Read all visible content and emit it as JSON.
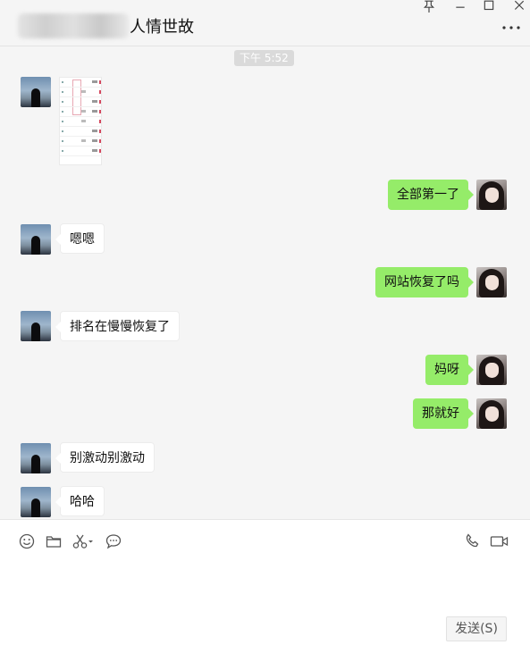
{
  "window": {
    "pin_icon": "pin-icon",
    "minimize_icon": "minimize-icon",
    "maximize_icon": "maximize-icon",
    "close_icon": "close-icon"
  },
  "header": {
    "contact_name": "人情世故",
    "more_icon": "more-dots-icon"
  },
  "chat": {
    "timestamp": "下午 5:52",
    "messages": [
      {
        "side": "left",
        "type": "image"
      },
      {
        "side": "right",
        "text": "全部第一了"
      },
      {
        "side": "left",
        "text": "嗯嗯"
      },
      {
        "side": "right",
        "text": "网站恢复了吗"
      },
      {
        "side": "left",
        "text": "排名在慢慢恢复了"
      },
      {
        "side": "right",
        "text": "妈呀"
      },
      {
        "side": "right",
        "text": "那就好"
      },
      {
        "side": "left",
        "text": "别激动别激动"
      },
      {
        "side": "left",
        "text": "哈哈"
      }
    ]
  },
  "toolbar": {
    "icons": [
      "emoji-icon",
      "folder-icon",
      "scissors-icon",
      "chat-bubble-icon",
      "phone-icon",
      "video-icon"
    ]
  },
  "composer": {
    "send_label": "发送(S)"
  },
  "colors": {
    "sent_bubble": "#95ec69",
    "received_bubble": "#ffffff",
    "background": "#f5f5f5"
  }
}
